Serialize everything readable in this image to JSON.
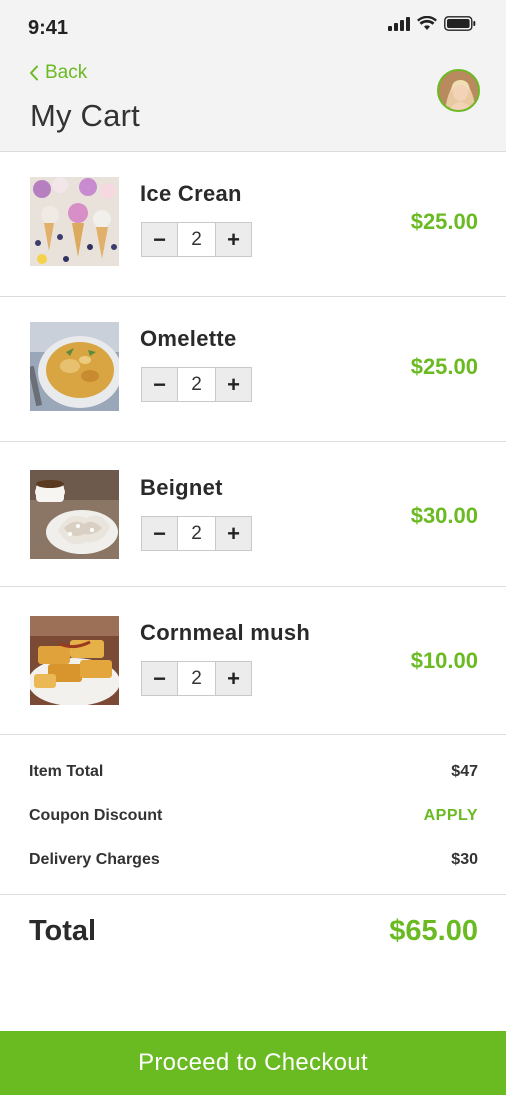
{
  "status_bar": {
    "time": "9:41"
  },
  "header": {
    "back_label": "Back",
    "title": "My Cart"
  },
  "items": [
    {
      "name": "Ice Crean",
      "qty": "2",
      "price": "$25.00",
      "image": "ice-cream-cones"
    },
    {
      "name": "Omelette",
      "qty": "2",
      "price": "$25.00",
      "image": "omelette-plate"
    },
    {
      "name": "Beignet",
      "qty": "2",
      "price": "$30.00",
      "image": "beignets-coffee"
    },
    {
      "name": "Cornmeal mush",
      "qty": "2",
      "price": "$10.00",
      "image": "fried-cornmeal-slices"
    }
  ],
  "stepper": {
    "minus": "−",
    "plus": "+"
  },
  "summary": {
    "item_total_label": "Item Total",
    "item_total_value": "$47",
    "coupon_label": "Coupon Discount",
    "coupon_action": "APPLY",
    "delivery_label": "Delivery Charges",
    "delivery_value": "$30"
  },
  "total": {
    "label": "Total",
    "value": "$65.00"
  },
  "checkout_label": "Proceed to Checkout",
  "colors": {
    "accent": "#6aba22",
    "header_bg": "#f3f3f3",
    "divider": "#dcdcdc"
  }
}
